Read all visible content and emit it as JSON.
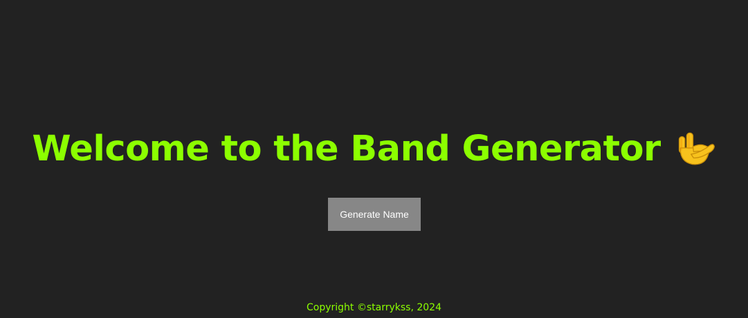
{
  "page": {
    "background_color": "#222222",
    "accent_color": "#8cff00"
  },
  "header": {
    "title": "Welcome to the Band Generator",
    "emoji_icon": "sign-of-the-horns-icon"
  },
  "main": {
    "generate_button_label": "Generate Name",
    "button_color": "#878787"
  },
  "footer": {
    "copyright": "Copyright ©starrykss, 2024"
  }
}
